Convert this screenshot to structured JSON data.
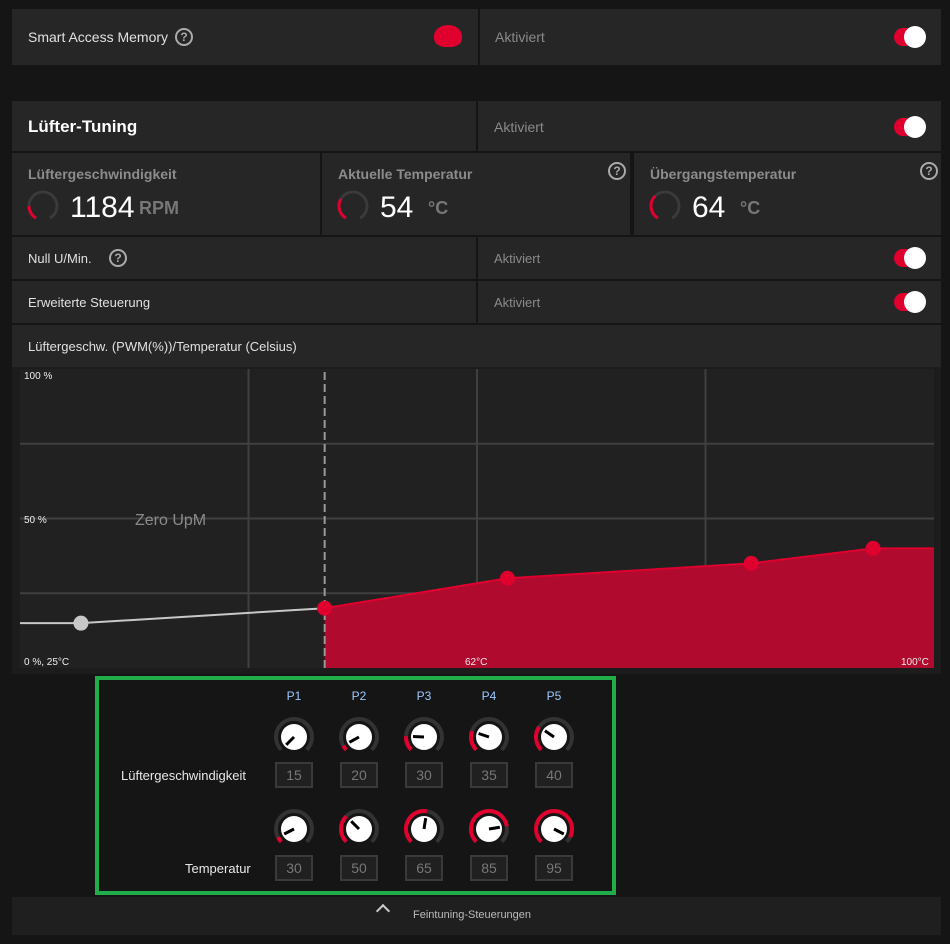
{
  "sam": {
    "label": "Smart Access Memory",
    "help": "?",
    "status": "Aktiviert",
    "enabled": true
  },
  "fan_tuning": {
    "title": "Lüfter-Tuning",
    "status": "Aktiviert",
    "enabled": true
  },
  "stats": [
    {
      "title": "Lüftergeschwindigkeit",
      "value": "1184",
      "unit": "RPM",
      "fraction": 0.2
    },
    {
      "title": "Aktuelle Temperatur",
      "value": "54",
      "unit": "°C",
      "fraction": 0.3
    },
    {
      "title": "Übergangstemperatur",
      "value": "64",
      "unit": "°C",
      "fraction": 0.35
    }
  ],
  "zero_rpm": {
    "label": "Null U/Min.",
    "status": "Aktiviert",
    "enabled": true
  },
  "advanced": {
    "label": "Erweiterte Steuerung",
    "status": "Aktiviert",
    "enabled": true
  },
  "curve_title": "Lüftergeschw. (PWM(%))/Temperatur (Celsius)",
  "chart_data": {
    "type": "area",
    "xlim": [
      25,
      100
    ],
    "ylim": [
      0,
      100
    ],
    "points": [
      {
        "name": "P1",
        "temp": 30,
        "fan": 15
      },
      {
        "name": "P2",
        "temp": 50,
        "fan": 20
      },
      {
        "name": "P3",
        "temp": 65,
        "fan": 30
      },
      {
        "name": "P4",
        "temp": 85,
        "fan": 35
      },
      {
        "name": "P5",
        "temp": 95,
        "fan": 40
      }
    ],
    "zero_rpm_threshold": 50,
    "labels": {
      "y_top": "100 %",
      "y_mid": "50 %",
      "origin": "0 %, 25°C",
      "x_mid": "62°C",
      "x_max": "100°C",
      "zone": "Zero UpM"
    },
    "colors": {
      "fill": "#b00a2e",
      "line": "#e0002e",
      "inactive": "#c8c8c8"
    }
  },
  "fine_tuning": {
    "row_fan_label": "Lüftergeschwindigkeit",
    "row_temp_label": "Temperatur",
    "points": [
      "P1",
      "P2",
      "P3",
      "P4",
      "P5"
    ],
    "fan": [
      "15",
      "20",
      "30",
      "35",
      "40"
    ],
    "temp": [
      "30",
      "50",
      "65",
      "85",
      "95"
    ]
  },
  "footer": {
    "label": "Feintuning-Steuerungen"
  }
}
